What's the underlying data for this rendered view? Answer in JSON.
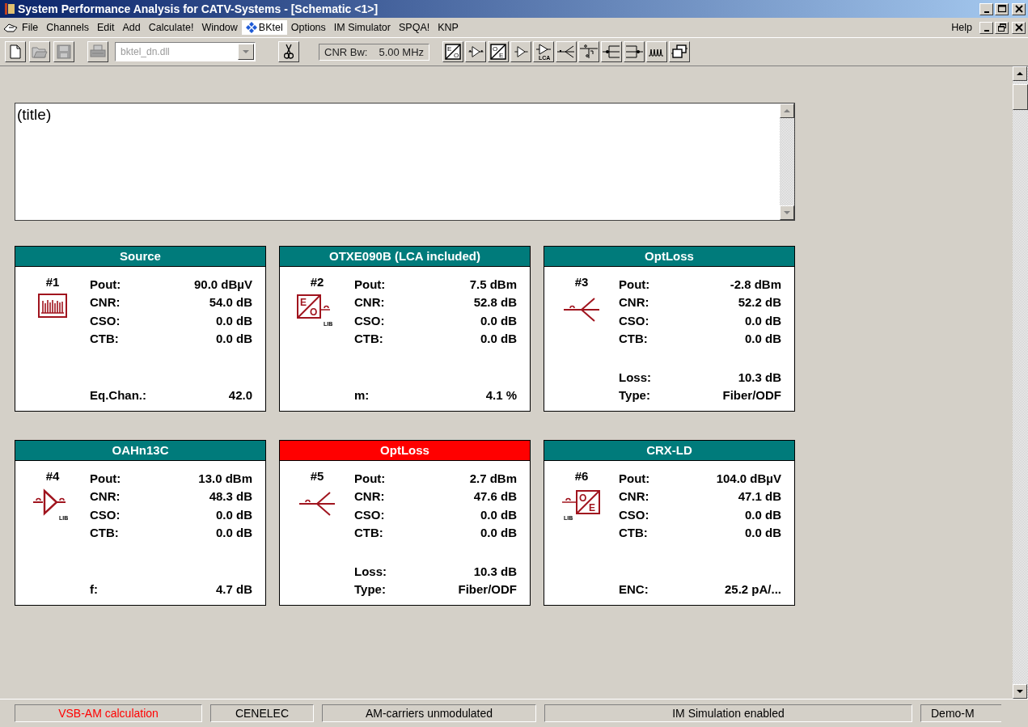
{
  "window": {
    "title": "System Performance Analysis for CATV-Systems - [Schematic <1>]"
  },
  "menu": {
    "items": [
      {
        "label": "File",
        "selected": false,
        "kind": "text"
      },
      {
        "label": "Channels",
        "selected": false,
        "kind": "text"
      },
      {
        "label": "Edit",
        "selected": false,
        "kind": "text"
      },
      {
        "label": "Add",
        "selected": false,
        "kind": "text"
      },
      {
        "label": "Calculate!",
        "selected": false,
        "kind": "text"
      },
      {
        "label": "Window",
        "selected": false,
        "kind": "text"
      },
      {
        "label": "BKtel",
        "selected": true,
        "kind": "logo"
      },
      {
        "label": "Options",
        "selected": false,
        "kind": "text"
      },
      {
        "label": "IM Simulator",
        "selected": false,
        "kind": "text"
      },
      {
        "label": "SPQA!",
        "selected": false,
        "kind": "text"
      },
      {
        "label": "KNP",
        "selected": false,
        "kind": "text"
      }
    ],
    "help": "Help"
  },
  "toolbar": {
    "file_buttons": [
      {
        "kind": "new",
        "disabled": false
      },
      {
        "kind": "open",
        "disabled": true
      },
      {
        "kind": "save",
        "disabled": true
      },
      {
        "kind": "print",
        "disabled": true
      }
    ],
    "library": {
      "value": "bktel_dn.dll",
      "disabled": true
    },
    "cnr_bw": {
      "label": "CNR Bw:",
      "value": "5.00 MHz"
    },
    "component_buttons": [
      {
        "kind": "eo",
        "letters": [
          "E",
          "O"
        ]
      },
      {
        "kind": "amp-fiber"
      },
      {
        "kind": "oe",
        "letters": [
          "O",
          "E"
        ]
      },
      {
        "kind": "amp"
      },
      {
        "kind": "amp-lca",
        "letters": [
          "LCA"
        ]
      },
      {
        "kind": "splitter"
      },
      {
        "kind": "tap"
      },
      {
        "kind": "split-left"
      },
      {
        "kind": "split-right"
      },
      {
        "kind": "spectrum"
      },
      {
        "kind": "windows"
      }
    ]
  },
  "title_box": {
    "value": "(title)"
  },
  "cards": [
    {
      "number": "#1",
      "title": "Source",
      "selected": false,
      "kind": "source",
      "rows": [
        {
          "label": "Pout:",
          "value": "90.0 dBµV"
        },
        {
          "label": "CNR:",
          "value": "54.0 dB"
        },
        {
          "label": "CSO:",
          "value": "0.0 dB"
        },
        {
          "label": "CTB:",
          "value": "0.0 dB"
        }
      ],
      "bottom_rows": [
        {
          "label": "Eq.Chan.:",
          "value": "42.0"
        }
      ]
    },
    {
      "number": "#2",
      "title": "OTXE090B (LCA included)",
      "selected": false,
      "kind": "eo",
      "icon_letters": [
        "E",
        "O"
      ],
      "icon_label": "LIB",
      "rows": [
        {
          "label": "Pout:",
          "value": "7.5 dBm"
        },
        {
          "label": "CNR:",
          "value": "52.8 dB"
        },
        {
          "label": "CSO:",
          "value": "0.0 dB"
        },
        {
          "label": "CTB:",
          "value": "0.0 dB"
        }
      ],
      "bottom_rows": [
        {
          "label": "m:",
          "value": "4.1 %"
        }
      ]
    },
    {
      "number": "#3",
      "title": "OptLoss",
      "selected": false,
      "kind": "optloss",
      "rows": [
        {
          "label": "Pout:",
          "value": "-2.8 dBm"
        },
        {
          "label": "CNR:",
          "value": "52.2 dB"
        },
        {
          "label": "CSO:",
          "value": "0.0 dB"
        },
        {
          "label": "CTB:",
          "value": "0.0 dB"
        }
      ],
      "bottom_rows": [
        {
          "label": "Loss:",
          "value": "10.3 dB"
        },
        {
          "label": "Type:",
          "value": "Fiber/ODF"
        }
      ]
    },
    {
      "number": "#4",
      "title": "OAHn13C",
      "selected": false,
      "kind": "amp",
      "icon_label": "LIB",
      "rows": [
        {
          "label": "Pout:",
          "value": "13.0 dBm"
        },
        {
          "label": "CNR:",
          "value": "48.3 dB"
        },
        {
          "label": "CSO:",
          "value": "0.0 dB"
        },
        {
          "label": "CTB:",
          "value": "0.0 dB"
        }
      ],
      "bottom_rows": [
        {
          "label": "f:",
          "value": "4.7 dB"
        }
      ]
    },
    {
      "number": "#5",
      "title": "OptLoss",
      "selected": true,
      "kind": "optloss",
      "rows": [
        {
          "label": "Pout:",
          "value": "2.7 dBm"
        },
        {
          "label": "CNR:",
          "value": "47.6 dB"
        },
        {
          "label": "CSO:",
          "value": "0.0 dB"
        },
        {
          "label": "CTB:",
          "value": "0.0 dB"
        }
      ],
      "bottom_rows": [
        {
          "label": "Loss:",
          "value": "10.3 dB"
        },
        {
          "label": "Type:",
          "value": "Fiber/ODF"
        }
      ]
    },
    {
      "number": "#6",
      "title": "CRX-LD",
      "selected": false,
      "kind": "oe",
      "icon_letters": [
        "O",
        "E"
      ],
      "icon_label": "LIB",
      "rows": [
        {
          "label": "Pout:",
          "value": "104.0 dBµV"
        },
        {
          "label": "CNR:",
          "value": "47.1 dB"
        },
        {
          "label": "CSO:",
          "value": "0.0 dB"
        },
        {
          "label": "CTB:",
          "value": "0.0 dB"
        }
      ],
      "bottom_rows": [
        {
          "label": "ENC:",
          "value": "25.2 pA/..."
        }
      ]
    }
  ],
  "status_bar": [
    {
      "text": "VSB-AM calculation",
      "alert": true
    },
    {
      "text": "CENELEC",
      "alert": false
    },
    {
      "text": "AM-carriers unmodulated",
      "alert": false
    },
    {
      "text": "IM Simulation enabled",
      "alert": false
    },
    {
      "text": "Demo-M",
      "alert": false
    }
  ]
}
